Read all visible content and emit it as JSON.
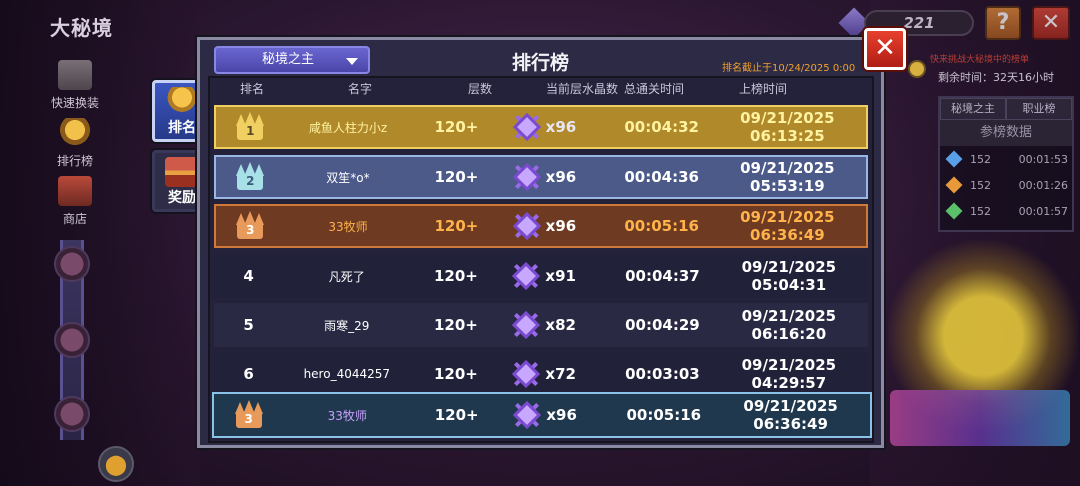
{
  "scene": {
    "title": "大秘境",
    "side_menu": [
      {
        "label": "快速换装",
        "icon": "swap-gear-icon"
      },
      {
        "label": "排行榜",
        "icon": "trophy-icon"
      },
      {
        "label": "商店",
        "icon": "shop-icon"
      }
    ],
    "crystal_count": "221",
    "help_label": "?",
    "close_label": "✕",
    "promo_line1": "快来挑战大秘境中的榜单",
    "promo_remaining": "剩余时间：32天16小时",
    "side_leaderboard": {
      "tabs": [
        "秘境之主",
        "职业榜"
      ],
      "heading": "参榜数据",
      "rows": [
        {
          "level": "152",
          "time": "00:01:53",
          "gem_color": "#5aa0e8"
        },
        {
          "level": "152",
          "time": "00:01:26",
          "gem_color": "#e89a3a"
        },
        {
          "level": "152",
          "time": "00:01:57",
          "gem_color": "#5ac06a"
        }
      ]
    }
  },
  "leaderboard": {
    "title": "排行榜",
    "mode": "秘境之主",
    "cutoff": "排名截止于10/24/2025 0:00",
    "close_label": "✕",
    "tabs": [
      {
        "label": "排名",
        "active": true
      },
      {
        "label": "奖励",
        "active": false
      }
    ],
    "columns": [
      "排名",
      "名字",
      "层数",
      "当前层水晶数",
      "总通关时间",
      "上榜时间"
    ],
    "rows": [
      {
        "rank": "1",
        "name": "咸鱼人柱力小z",
        "floor": "120+",
        "crystals": "x96",
        "time": "00:04:32",
        "date": "09/21/2025 06:13:25"
      },
      {
        "rank": "2",
        "name": "双笙*o*",
        "floor": "120+",
        "crystals": "x96",
        "time": "00:04:36",
        "date": "09/21/2025 05:53:19"
      },
      {
        "rank": "3",
        "name": "33牧师",
        "floor": "120+",
        "crystals": "x96",
        "time": "00:05:16",
        "date": "09/21/2025 06:36:49"
      },
      {
        "rank": "4",
        "name": "凡死了",
        "floor": "120+",
        "crystals": "x91",
        "time": "00:04:37",
        "date": "09/21/2025 05:04:31"
      },
      {
        "rank": "5",
        "name": "雨寒_29",
        "floor": "120+",
        "crystals": "x82",
        "time": "00:04:29",
        "date": "09/21/2025 06:16:20"
      },
      {
        "rank": "6",
        "name": "hero_4044257",
        "floor": "120+",
        "crystals": "x72",
        "time": "00:03:03",
        "date": "09/21/2025 04:29:57"
      }
    ],
    "self_row": {
      "rank": "3",
      "name": "33牧师",
      "floor": "120+",
      "crystals": "x96",
      "time": "00:05:16",
      "date": "09/21/2025 06:36:49"
    },
    "colors": {
      "gold": "#b08a2a",
      "silver": "#4c5a8a",
      "bronze": "#6e3a22",
      "self": "#20384e",
      "self_name": "#c8a0ff"
    }
  }
}
